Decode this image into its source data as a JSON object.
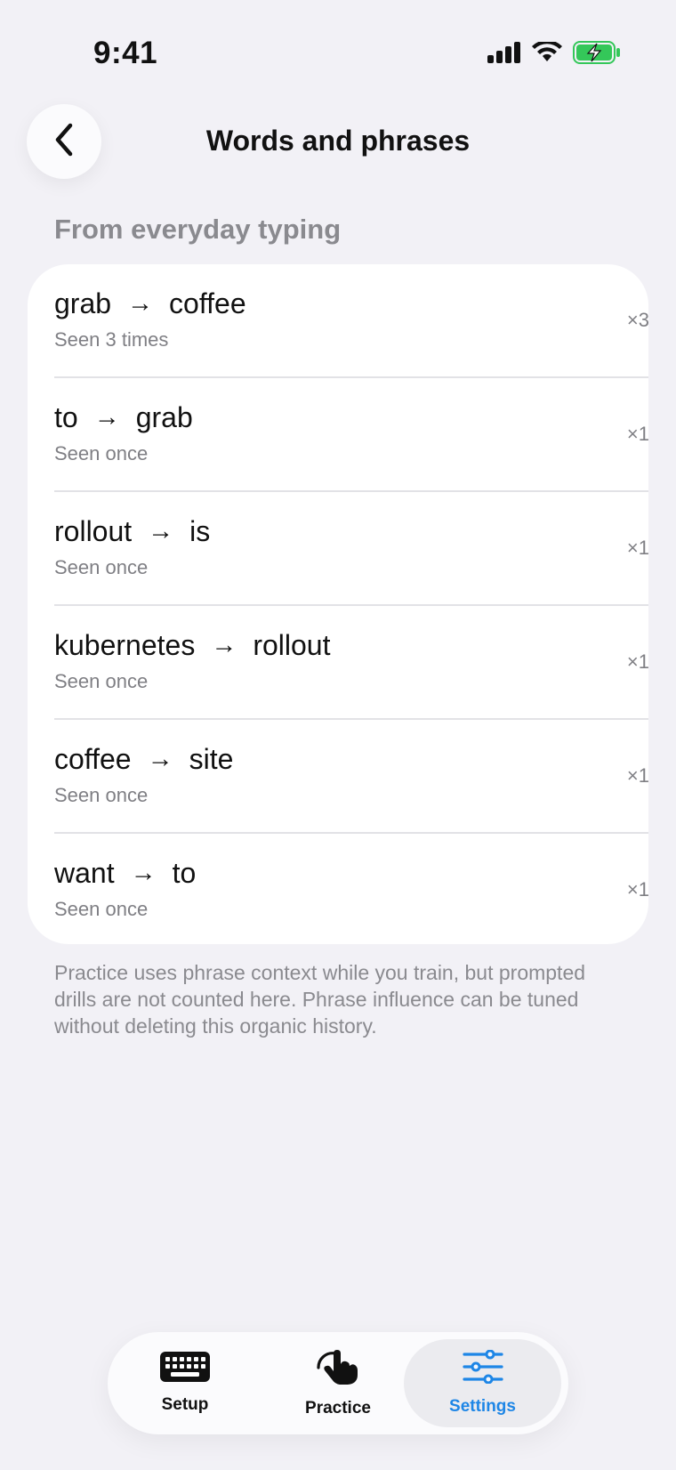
{
  "status_bar": {
    "time": "9:41",
    "icons": [
      "cellular-signal-icon",
      "wifi-icon",
      "battery-charging-icon"
    ],
    "battery_color": "#34c759"
  },
  "header": {
    "back_icon": "chevron-left-icon",
    "title": "Words and phrases"
  },
  "section": {
    "title": "From everyday typing"
  },
  "phrases": [
    {
      "from": "grab",
      "to": "coffee",
      "arrow": "→",
      "subtitle": "Seen 3 times",
      "count": "×3"
    },
    {
      "from": "to",
      "to": "grab",
      "arrow": "→",
      "subtitle": "Seen once",
      "count": "×1"
    },
    {
      "from": "rollout",
      "to": "is",
      "arrow": "→",
      "subtitle": "Seen once",
      "count": "×1"
    },
    {
      "from": "kubernetes",
      "to": "rollout",
      "arrow": "→",
      "subtitle": "Seen once",
      "count": "×1"
    },
    {
      "from": "coffee",
      "to": "site",
      "arrow": "→",
      "subtitle": "Seen once",
      "count": "×1"
    },
    {
      "from": "want",
      "to": "to",
      "arrow": "→",
      "subtitle": "Seen once",
      "count": "×1"
    }
  ],
  "footnote": "Practice uses phrase context while you train, but prompted drills are not counted here. Phrase influence can be tuned without deleting this organic history.",
  "tab_bar": {
    "tabs": [
      {
        "label": "Setup",
        "icon": "keyboard-icon",
        "active": false
      },
      {
        "label": "Practice",
        "icon": "hand-tap-icon",
        "active": false
      },
      {
        "label": "Settings",
        "icon": "sliders-icon",
        "active": true
      }
    ],
    "active_color": "#1e86e6"
  }
}
